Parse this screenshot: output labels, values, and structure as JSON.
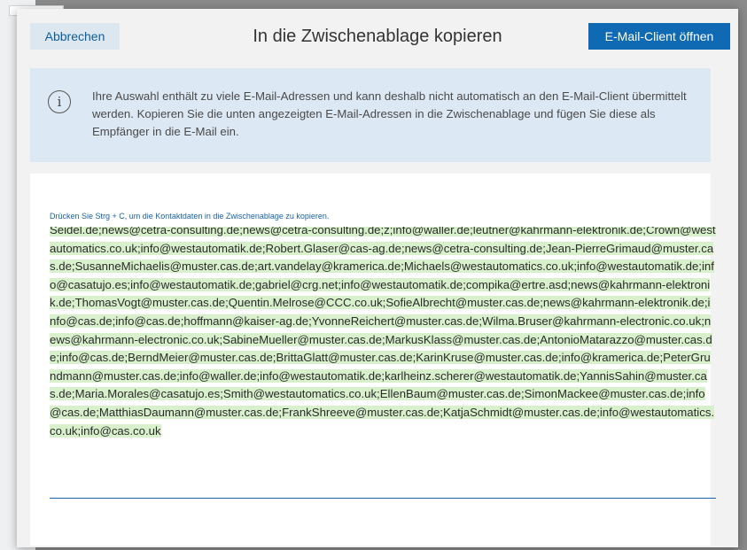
{
  "dialog": {
    "cancel_label": "Abbrechen",
    "title": "In die Zwischenablage kopieren",
    "open_client_label": "E-Mail-Client öffnen"
  },
  "info": {
    "icon": "info-icon",
    "glyph": "i",
    "message": "Ihre Auswahl enthält zu viele E-Mail-Adressen und kann deshalb nicht automatisch an den E-Mail-Client übermittelt werden. Kopieren Sie die unten angezeigten E-Mail-Adressen in die Zwischenablage und fügen Sie diese als Empfänger in die E-Mail ein."
  },
  "copy": {
    "hint": "Drücken Sie Strg + C, um die Kontaktdaten in die Zwischenablage zu kopieren.",
    "emails_text": "Seidel.de;news@cetra-consulting.de;news@cetra-consulting.de;z;info@waller.de;leutner@kahrmann-elektronik.de;Crown@westautomatics.co.uk;info@westautomatik.de;Robert.Glaser@cas-ag.de;news@cetra-consulting.de;Jean-PierreGrimaud@muster.cas.de;SusanneMichaelis@muster.cas.de;art.vandelay@kramerica.de;Michaels@westautomatics.co.uk;info@westautomatik.de;info@casatujo.es;info@westautomatik.de;gabriel@crg.net;info@westautomatik.de;compika@ertre.asd;news@kahrmann-elektronik.de;ThomasVogt@muster.cas.de;Quentin.Melrose@CCC.co.uk;SofieAlbrecht@muster.cas.de;news@kahrmann-elektronik.de;info@cas.de;info@cas.de;hoffmann@kaiser-ag.de;YvonneReichert@muster.cas.de;Wilma.Bruser@kahrmann-electronic.co.uk;news@kahrmann-electronic.co.uk;SabineMueller@muster.cas.de;MarkusKlass@muster.cas.de;AntonioMatarazzo@muster.cas.de;info@cas.de;BerndMeier@muster.cas.de;BrittaGlatt@muster.cas.de;KarinKruse@muster.cas.de;info@kramerica.de;PeterGrundmann@muster.cas.de;info@waller.de;info@westautomatik.de;karlheinz.scherer@westautomatik.de;YannisSahin@muster.cas.de;Maria.Morales@casatujo.es;Smith@westautomatics.co.uk;EllenBaum@muster.cas.de;SimonMackee@muster.cas.de;info@cas.de;MatthiasDaumann@muster.cas.de;FrankShreeve@muster.cas.de;KatjaSchmidt@muster.cas.de;info@westautomatics.co.uk;info@cas.co.uk"
  },
  "colors": {
    "primary": "#0f6ab3",
    "info_bg": "#dce8f3",
    "selection": "#d8f0cc",
    "link": "#1a63a8"
  }
}
